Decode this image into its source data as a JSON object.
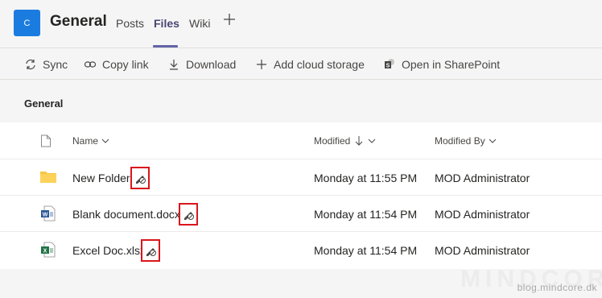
{
  "header": {
    "avatar_letter": "C",
    "channel_title": "General",
    "tabs": [
      {
        "label": "Posts"
      },
      {
        "label": "Files"
      },
      {
        "label": "Wiki"
      }
    ],
    "add_tab_icon": "plus-icon"
  },
  "toolbar": {
    "sync": {
      "label": "Sync",
      "icon": "sync-icon"
    },
    "copy_link": {
      "label": "Copy link",
      "icon": "link-icon"
    },
    "download": {
      "label": "Download",
      "icon": "download-icon"
    },
    "add_cloud": {
      "label": "Add cloud storage",
      "icon": "plus-icon"
    },
    "sharepoint": {
      "label": "Open in SharePoint",
      "icon": "sharepoint-icon"
    }
  },
  "section_title": "General",
  "columns": {
    "name": "Name",
    "modified": "Modified",
    "modified_by": "Modified By"
  },
  "rows": [
    {
      "name": "New Folder",
      "type": "folder",
      "modified": "Monday at 11:55 PM",
      "modified_by": "MOD Administrator"
    },
    {
      "name": "Blank document.docx",
      "type": "word",
      "modified": "Monday at 11:54 PM",
      "modified_by": "MOD Administrator"
    },
    {
      "name": "Excel Doc.xlsx",
      "type": "excel",
      "modified": "Monday at 11:54 PM",
      "modified_by": "MOD Administrator"
    }
  ],
  "watermark": {
    "large": "MINDCORE",
    "small": "blog.mindcore.dk"
  },
  "colors": {
    "accent": "#6264a7",
    "avatar": "#1b7ce0",
    "highlight": "#d9161c",
    "folder": "#f8c545",
    "word": "#2b579a",
    "excel": "#217346"
  }
}
